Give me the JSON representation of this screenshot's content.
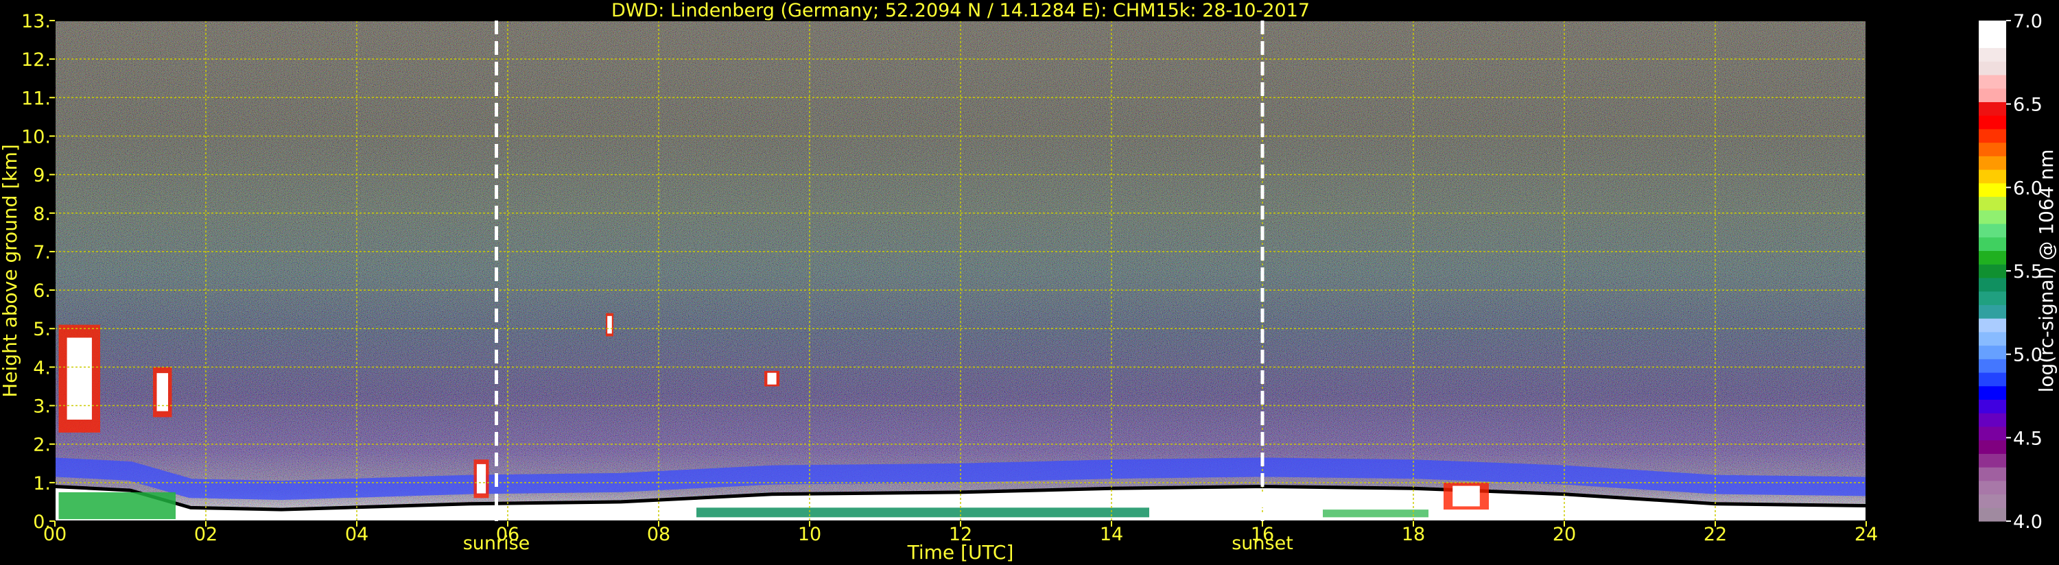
{
  "chart_data": {
    "type": "heatmap",
    "title": "DWD: Lindenberg (Germany; 52.2094 N / 14.1284 E):     CHM15k: 28-10-2017",
    "xlabel": "Time [UTC]",
    "ylabel": "Height above ground [km]",
    "xlim": [
      0,
      24
    ],
    "ylim": [
      0,
      13
    ],
    "x_ticks": [
      "00",
      "02",
      "04",
      "06",
      "08",
      "10",
      "12",
      "14",
      "16",
      "18",
      "20",
      "22",
      "24"
    ],
    "y_ticks": [
      "0.",
      "1.",
      "2.",
      "3.",
      "4.",
      "5.",
      "6.",
      "7.",
      "8.",
      "9.",
      "10.",
      "11.",
      "12.",
      "13."
    ],
    "grid": true,
    "markers": [
      {
        "label": "sunrise",
        "x": 5.85
      },
      {
        "label": "sunset",
        "x": 16.0
      }
    ],
    "colorbar": {
      "label": "log(rc-signal) @ 1064 nm",
      "range": [
        4.0,
        7.0
      ],
      "ticks": [
        "4.0",
        "4.5",
        "5.0",
        "5.5",
        "6.0",
        "6.5",
        "7.0"
      ],
      "colors": [
        "#a08aa0",
        "#a986a9",
        "#a878a8",
        "#a060a0",
        "#903090",
        "#800080",
        "#7a00a0",
        "#6600c0",
        "#4000e0",
        "#0000ff",
        "#2244ff",
        "#4477ff",
        "#66a0ff",
        "#88bbff",
        "#aaccff",
        "#30a0a0",
        "#20a080",
        "#109060",
        "#109030",
        "#20b020",
        "#40d060",
        "#60e080",
        "#90f070",
        "#c0f040",
        "#ffff00",
        "#ffcc00",
        "#ff9900",
        "#ff6600",
        "#ff3300",
        "#ff0000",
        "#ee1111",
        "#ffaaaa",
        "#ffbbbb",
        "#f0dede",
        "#f4e8e8",
        "#ffffff",
        "#ffffff"
      ]
    },
    "boundary_layer_top_km": [
      {
        "x": 0.0,
        "y": 0.9
      },
      {
        "x": 1.0,
        "y": 0.8
      },
      {
        "x": 1.8,
        "y": 0.35
      },
      {
        "x": 3.0,
        "y": 0.3
      },
      {
        "x": 5.5,
        "y": 0.45
      },
      {
        "x": 7.5,
        "y": 0.5
      },
      {
        "x": 9.5,
        "y": 0.7
      },
      {
        "x": 12.0,
        "y": 0.75
      },
      {
        "x": 14.0,
        "y": 0.85
      },
      {
        "x": 16.0,
        "y": 0.9
      },
      {
        "x": 18.0,
        "y": 0.85
      },
      {
        "x": 20.0,
        "y": 0.7
      },
      {
        "x": 22.0,
        "y": 0.45
      },
      {
        "x": 24.0,
        "y": 0.4
      }
    ],
    "cloud_features": [
      {
        "x0": 0.05,
        "x1": 0.6,
        "y0": 2.3,
        "y1": 5.1
      },
      {
        "x0": 1.3,
        "x1": 1.55,
        "y0": 2.7,
        "y1": 4.0
      },
      {
        "x0": 5.55,
        "x1": 5.75,
        "y0": 0.6,
        "y1": 1.6
      },
      {
        "x0": 9.4,
        "x1": 9.6,
        "y0": 3.5,
        "y1": 3.9
      },
      {
        "x0": 7.3,
        "x1": 7.4,
        "y0": 4.8,
        "y1": 5.4
      },
      {
        "x0": 18.4,
        "x1": 19.0,
        "y0": 0.3,
        "y1": 1.0
      }
    ]
  }
}
